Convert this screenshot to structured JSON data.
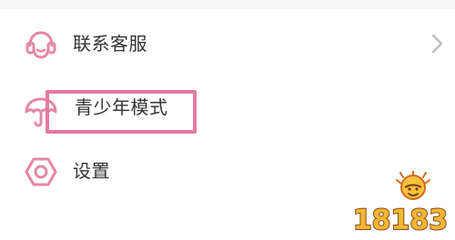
{
  "menu": {
    "items": [
      {
        "label": "联系客服",
        "icon": "headset-icon",
        "has_chevron": true
      },
      {
        "label": "青少年模式",
        "icon": "umbrella-icon",
        "has_chevron": false,
        "highlighted": true
      },
      {
        "label": "设置",
        "icon": "gear-icon",
        "has_chevron": false
      }
    ]
  },
  "colors": {
    "icon_pink": "#e487a8",
    "highlight_border": "#e47aa2",
    "label_text": "#333333",
    "chevron": "#bdbdbd"
  },
  "watermark": {
    "text": "18183",
    "logo": "sun-face-logo"
  }
}
